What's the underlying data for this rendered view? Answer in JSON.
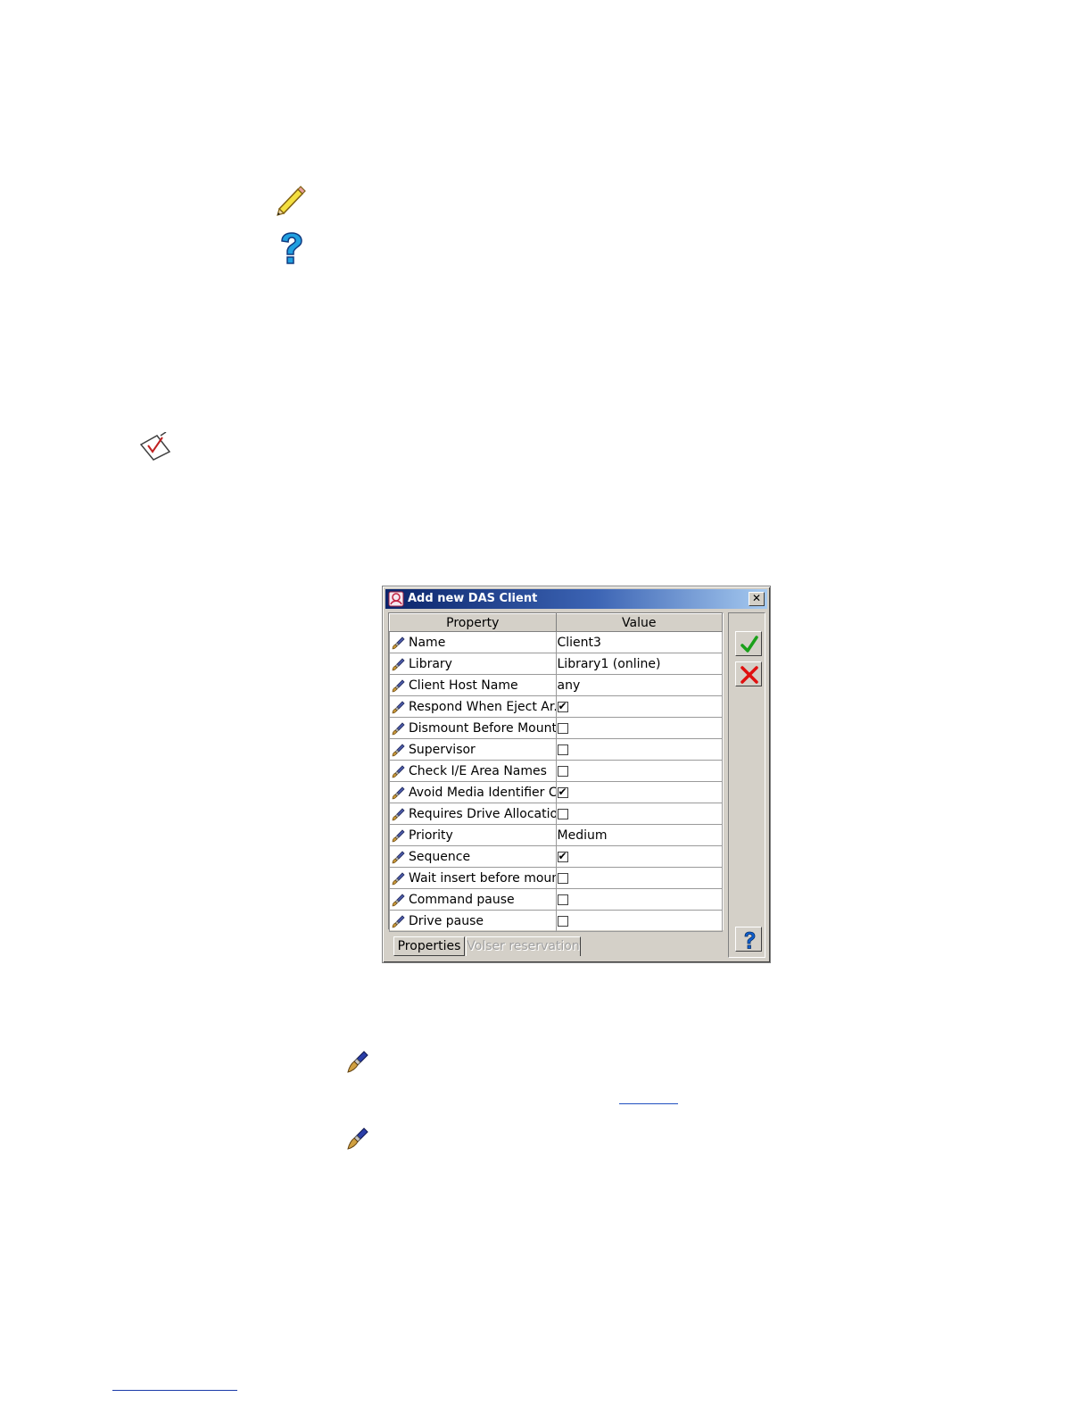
{
  "dialog": {
    "title": "Add new DAS Client",
    "close_glyph": "✕",
    "columns": [
      "Property",
      "Value"
    ],
    "rows": [
      {
        "property": "Name",
        "type": "text",
        "value": "Client3"
      },
      {
        "property": "Library",
        "type": "text",
        "value": "Library1 (online)"
      },
      {
        "property": "Client Host Name",
        "type": "text",
        "value": "any"
      },
      {
        "property": "Respond When Eject Ar...",
        "type": "checkbox",
        "checked": true
      },
      {
        "property": "Dismount Before Mount",
        "type": "checkbox",
        "checked": false
      },
      {
        "property": "Supervisor",
        "type": "checkbox",
        "checked": false
      },
      {
        "property": "Check I/E Area Names",
        "type": "checkbox",
        "checked": false
      },
      {
        "property": "Avoid Media Identifier C...",
        "type": "checkbox",
        "checked": true
      },
      {
        "property": "Requires Drive Allocation",
        "type": "checkbox",
        "checked": false
      },
      {
        "property": "Priority",
        "type": "text",
        "value": "Medium"
      },
      {
        "property": "Sequence",
        "type": "checkbox",
        "checked": true
      },
      {
        "property": "Wait insert before mount",
        "type": "checkbox",
        "checked": false
      },
      {
        "property": "Command pause",
        "type": "checkbox",
        "checked": false
      },
      {
        "property": "Drive pause",
        "type": "checkbox",
        "checked": false
      }
    ],
    "tabs": [
      {
        "label": "Properties",
        "active": true
      },
      {
        "label": "Volser reservation",
        "active": false
      }
    ],
    "buttons": {
      "ok_icon": "checkmark-icon",
      "cancel_icon": "red-x-icon",
      "help_icon": "question-icon"
    }
  },
  "page_icons": [
    "pencil-icon",
    "help-question-icon",
    "note-check-icon",
    "edit-brush-icon",
    "edit-brush-icon"
  ],
  "colors": {
    "title_bar_start": "#0a246a",
    "title_bar_end": "#a6caf0",
    "dialog_bg": "#d4d0c8",
    "ok_green": "#1aa01a",
    "cancel_red": "#e01010",
    "help_blue": "#1060d0"
  }
}
